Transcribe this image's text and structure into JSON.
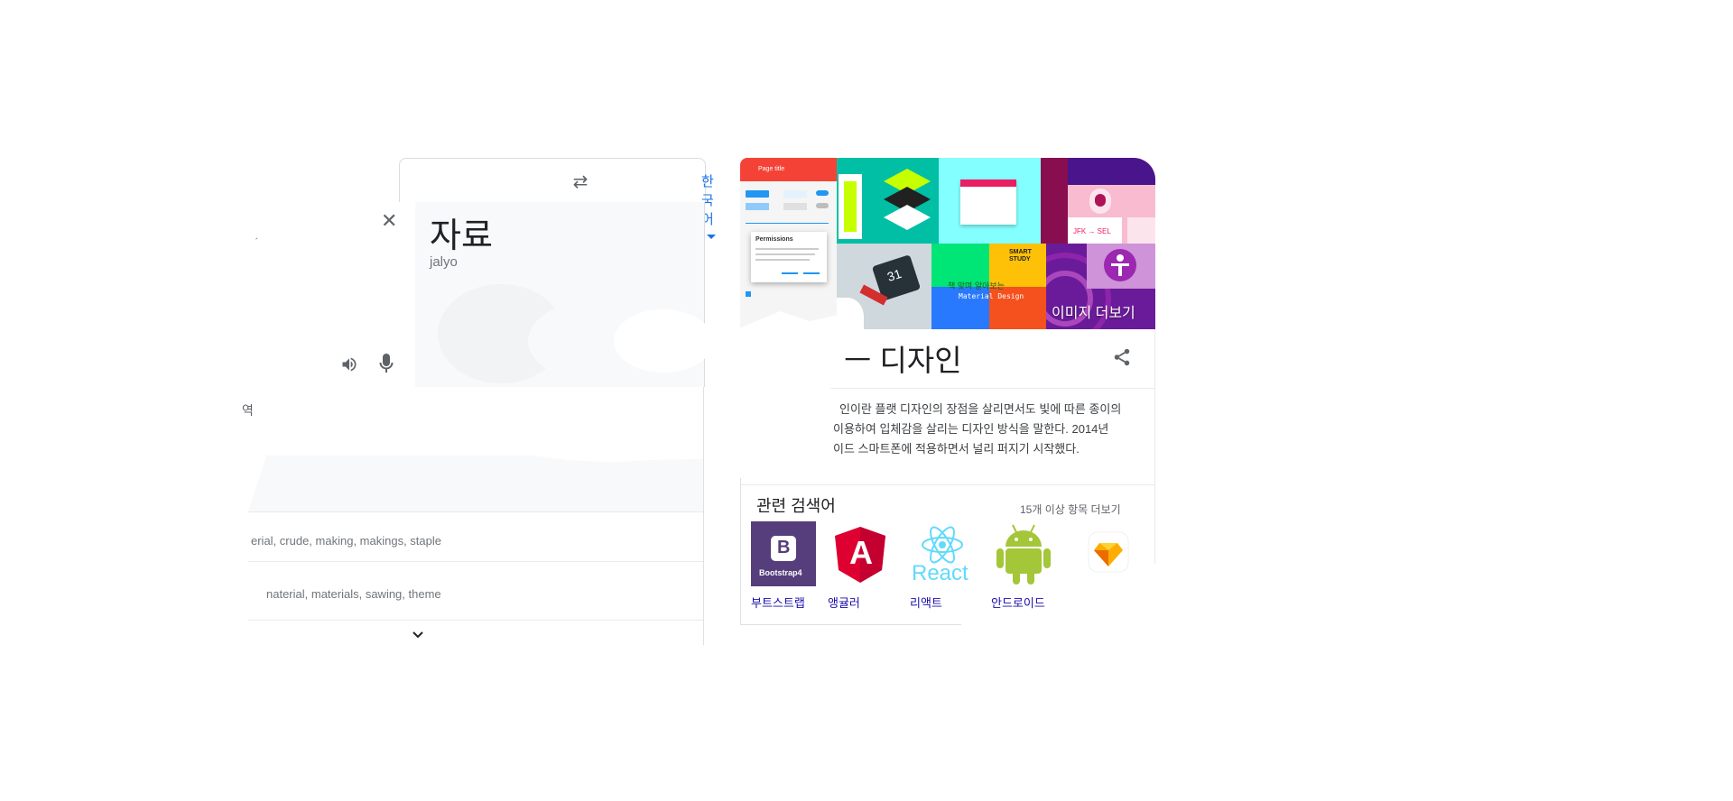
{
  "translate": {
    "target_language": "한국어",
    "swap_symbol": "⇄",
    "clear_symbol": "✕",
    "source_fragment": "ˏ",
    "translation": "자료",
    "romanization": "jalyo",
    "section_label_fragment": "역",
    "synonyms_row1": "erial, crude, making, makings, staple",
    "synonyms_row2": "naterial, materials, sawing, theme"
  },
  "knowledge_panel": {
    "more_images_label": "이미지 더보기",
    "title": "ㅡ 디자인",
    "description_lines": [
      "인이란 플랫 디자인의 장점을 살리면서도 빛에 따른 종이의",
      "이용하여 입체감을 살리는 디자인 방식을 말한다. 2014년",
      "이드 스마트폰에 적용하면서 널리 퍼지기 시작했다."
    ],
    "related_title": "관련 검색어",
    "related_more": "15개 이상 항목 더보기",
    "related_items": [
      {
        "name": "부트스트랩",
        "icon": "bootstrap-logo-icon",
        "icon_text": "B",
        "icon_subtext": "Bootstrap4"
      },
      {
        "name": "앵귤러",
        "icon": "angular-logo-icon",
        "icon_text": "A"
      },
      {
        "name": "리액트",
        "icon": "react-logo-icon",
        "icon_text": "React"
      },
      {
        "name": "안드로이드",
        "icon": "android-logo-icon"
      },
      {
        "name": "",
        "icon": "sketch-logo-icon"
      }
    ],
    "thumbnail_texts": {
      "mockup_title": "Page title",
      "dialog_title": "Permissions",
      "calendar_day": "31",
      "smart_study": "SMART STUDY",
      "korean_material": "책 맞며 알아보는",
      "material_design": "Material Design",
      "airport_codes": "JFK → SEL"
    }
  },
  "colors": {
    "accent_blue": "#1a73e8",
    "link_blue": "#1a0dab",
    "bootstrap_purple": "#563d7c",
    "angular_red": "#dd0031",
    "react_cyan": "#61dafb",
    "android_green": "#a4c639"
  }
}
